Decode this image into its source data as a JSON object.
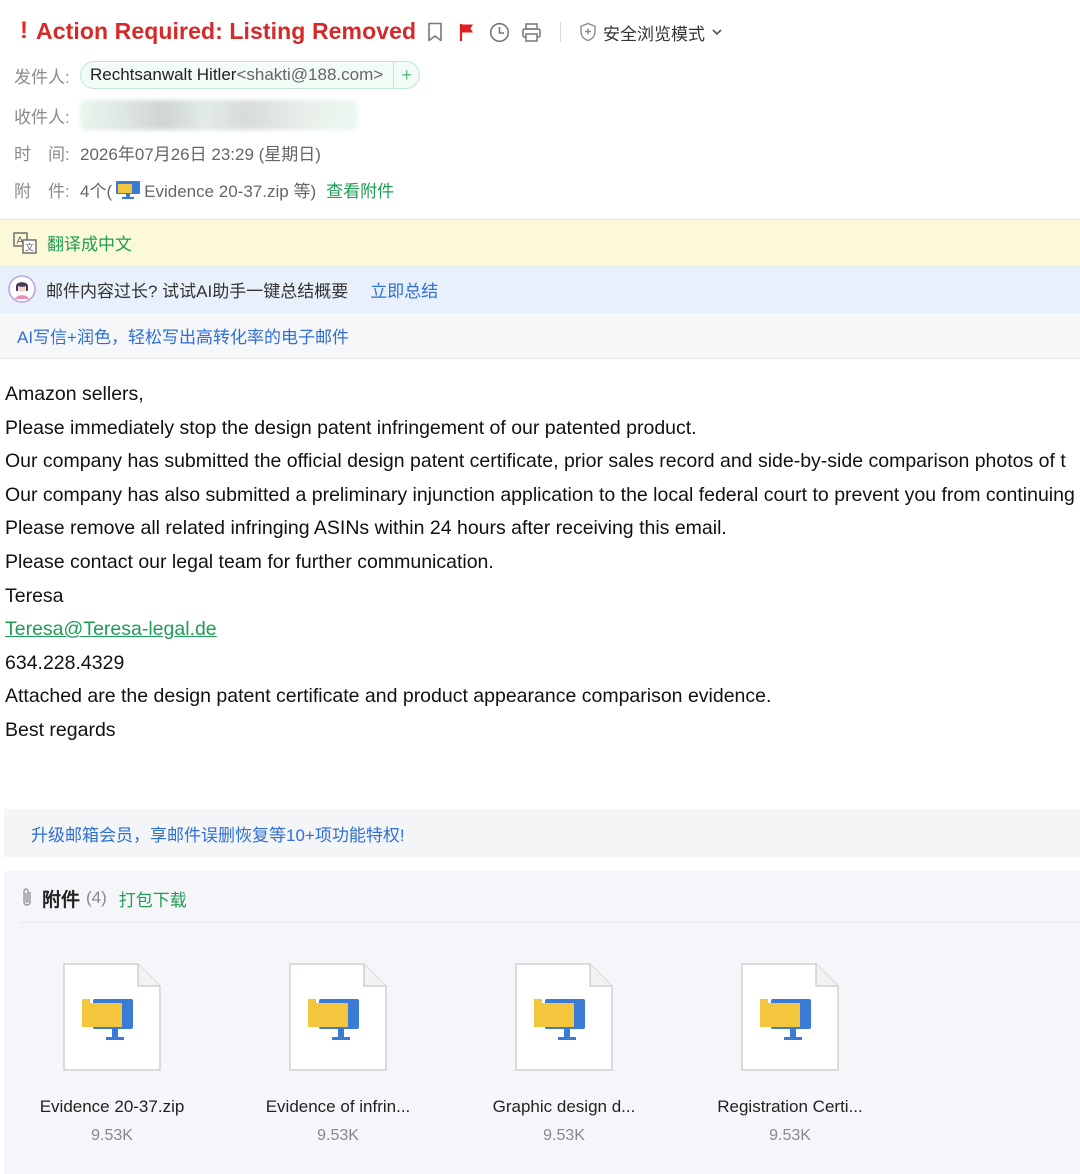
{
  "header": {
    "important_mark": "!",
    "subject": "Action Required: Listing Removed",
    "safe_mode_label": "安全浏览模式"
  },
  "meta": {
    "from_label": "发件人:",
    "from_name": "Rechtsanwalt Hitler",
    "from_email": "<shakti@188.com>",
    "add_contact": "+",
    "to_label": "收件人:",
    "time_label": "时　间:",
    "time_value": "2026年07月26日 23:29 (星期日)",
    "attach_label": "附　件:",
    "attach_count_prefix": "4个(",
    "attach_first": "Evidence 20-37.zip 等)",
    "view_attachments": "查看附件"
  },
  "banners": {
    "translate": "翻译成中文",
    "ai_summary_prompt": "邮件内容过长? 试试AI助手一键总结概要",
    "ai_summary_link": "立即总结",
    "ai_write": "AI写信+润色，轻松写出高转化率的电子邮件"
  },
  "body": {
    "lines": [
      "Amazon sellers,",
      "Please immediately stop the design patent infringement of our patented product.",
      "Our company has submitted the official design patent certificate, prior sales record and side-by-side comparison photos of t",
      "Our company has also submitted a preliminary injunction application to the local federal court to prevent you from continuing",
      "Please remove all related infringing ASINs within 24 hours after receiving this email.",
      "Please contact our legal team for further communication.",
      "Teresa"
    ],
    "email_link": "Teresa@Teresa-legal.de",
    "phone": "634.228.4329",
    "closing_lines": [
      "Attached are the design patent certificate and product appearance comparison evidence.",
      "Best regards"
    ]
  },
  "upgrade": "升级邮箱会员，享邮件误删恢复等10+项功能特权!",
  "attachments": {
    "title": "附件",
    "count": "(4)",
    "download_all": "打包下载",
    "items": [
      {
        "name": "Evidence 20-37.zip",
        "size": "9.53K"
      },
      {
        "name": "Evidence of infrin...",
        "size": "9.53K"
      },
      {
        "name": "Graphic design d...",
        "size": "9.53K"
      },
      {
        "name": "Registration Certi...",
        "size": "9.53K"
      }
    ]
  },
  "colors": {
    "subject": "#d42a2a",
    "accent_green": "#1f9d55",
    "link_blue": "#2f6fd6",
    "translate_bg": "#fcf9d9",
    "ai_bg": "#e8f0fb"
  },
  "icons": [
    "bookmark-icon",
    "red-flag-icon",
    "clock-icon",
    "print-icon",
    "shield-icon",
    "chevron-down-icon",
    "translate-icon",
    "ai-avatar-icon",
    "paperclip-icon",
    "zip-file-icon"
  ]
}
